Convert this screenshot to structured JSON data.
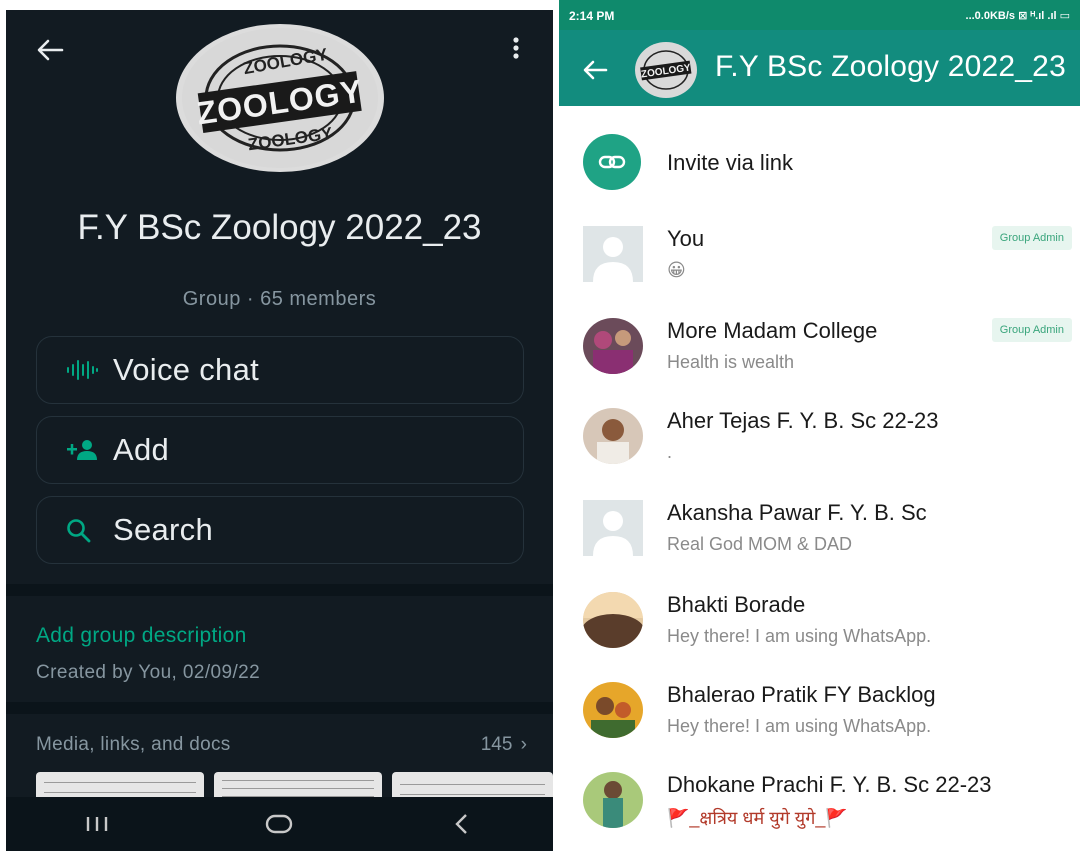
{
  "left_panel": {
    "avatar_text": {
      "top": "ZOOLOGY",
      "middle": "ZOOLOGY",
      "bottom": "ZOOLOGY"
    },
    "group_name": "F.Y BSc Zoology 2022_23",
    "group_sub": "Group · 65 members",
    "actions": [
      {
        "label": "Voice chat",
        "icon": "voice-wave-icon"
      },
      {
        "label": "Add",
        "icon": "add-person-icon"
      },
      {
        "label": "Search",
        "icon": "search-icon"
      }
    ],
    "description_link": "Add group description",
    "created": "Created by You, 02/09/22",
    "media_header": "Media, links, and docs",
    "media_count": "145",
    "colors": {
      "accent": "#00a884",
      "bg": "#121b22",
      "text_muted": "#8696a0"
    }
  },
  "right_panel": {
    "status": {
      "time": "2:14 PM",
      "icons": "...0.0KB/s ⊠ ᴴ.ıl .ıl ▭"
    },
    "header_title": "F.Y BSc Zoology 2022_23",
    "header_avatar_text": "ZOOLOGY",
    "invite_label": "Invite via link",
    "members": [
      {
        "name": "You",
        "status": "😀",
        "badge": "Group Admin",
        "avatar": "default"
      },
      {
        "name": "More Madam College",
        "status": "Health is wealth",
        "badge": "Group Admin",
        "avatar": "photo"
      },
      {
        "name": "Aher Tejas F. Y. B. Sc 22-23",
        "status": ".",
        "badge": "",
        "avatar": "photo"
      },
      {
        "name": "Akansha Pawar F. Y. B. Sc",
        "status": "Real God MOM & DAD",
        "badge": "",
        "avatar": "default"
      },
      {
        "name": "Bhakti Borade",
        "status": "Hey there! I am using WhatsApp.",
        "badge": "",
        "avatar": "photo"
      },
      {
        "name": "Bhalerao Pratik FY Backlog",
        "status": "Hey there! I am using WhatsApp.",
        "badge": "",
        "avatar": "photo"
      },
      {
        "name": "Dhokane Prachi F. Y. B. Sc 22-23",
        "status": "🚩_क्षत्रिय धर्म युगे युगे_🚩",
        "badge": "",
        "avatar": "photo"
      }
    ],
    "colors": {
      "header": "#128c7e",
      "status_bar": "#0f8a6c",
      "badge_text": "#3aa57c"
    }
  }
}
